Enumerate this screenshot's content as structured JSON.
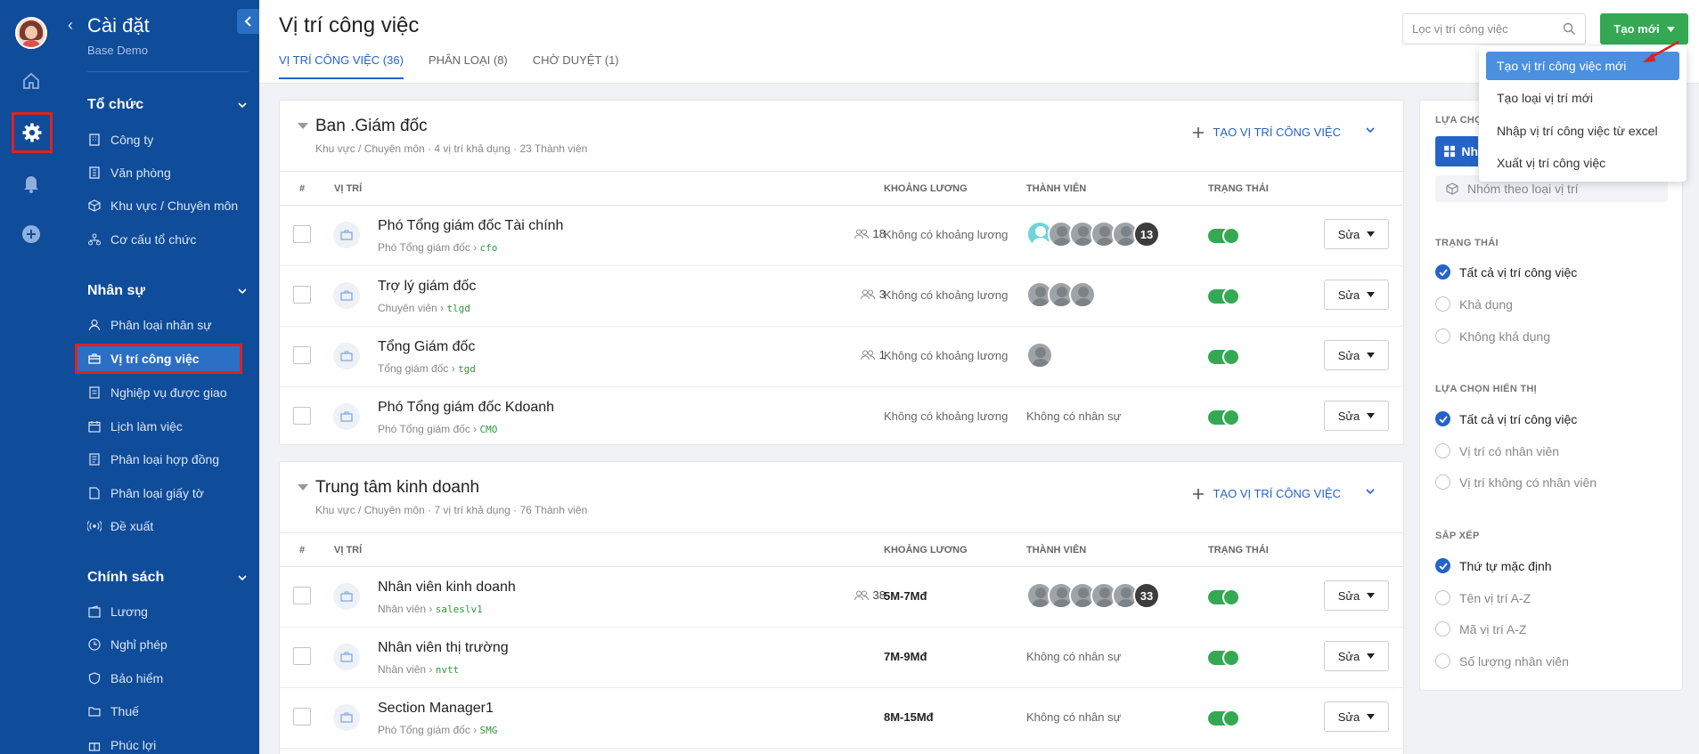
{
  "sidebar": {
    "title": "Cài đặt",
    "subtitle": "Base Demo",
    "groups": [
      {
        "label": "Tổ chức",
        "items": [
          "Công ty",
          "Văn phòng",
          "Khu vực / Chuyên môn",
          "Cơ cấu tổ chức"
        ]
      },
      {
        "label": "Nhân sự",
        "items": [
          "Phân loại nhân sự",
          "Vị trí công việc",
          "Nghiệp vụ được giao",
          "Lịch làm việc",
          "Phân loại hợp đồng",
          "Phân loại giấy tờ",
          "Đề xuất"
        ]
      },
      {
        "label": "Chính sách",
        "items": [
          "Lương",
          "Nghỉ phép",
          "Bảo hiểm",
          "Thuế",
          "Phúc lợi"
        ]
      }
    ]
  },
  "header": {
    "title": "Vị trí công việc",
    "tabs": [
      "VỊ TRÍ CÔNG VIỆC (36)",
      "PHÂN LOẠI (8)",
      "CHỜ DUYỆT (1)"
    ],
    "filter_placeholder": "Lọc vị trí công việc",
    "create_label": "Tạo mới"
  },
  "dropdown": {
    "items": [
      "Tạo vị trí công việc mới",
      "Tạo loại vị trí mới",
      "Nhập vị trí công việc từ excel",
      "Xuất vị trí công việc"
    ]
  },
  "table_headers": [
    "#",
    "VỊ TRÍ",
    "KHOẢNG LƯƠNG",
    "THÀNH VIÊN",
    "TRẠNG THÁI"
  ],
  "add_position_label": "TẠO VỊ TRÍ CÔNG VIỆC",
  "edit_label": "Sửa",
  "cards": [
    {
      "title": "Ban .Giám đốc",
      "meta": "Khu vực / Chuyên môn · 4 vị trí khả dụng · 23 Thành viên",
      "rows": [
        {
          "name": "Phó Tổng giám đốc Tài chính",
          "path": "Phó Tổng giám đốc ›",
          "code": "cfo",
          "count": "18",
          "salary": "Không có khoảng lương",
          "member_extra": "13",
          "no_members": ""
        },
        {
          "name": "Trợ lý giám đốc",
          "path": "Chuyên viên ›",
          "code": "tlgd",
          "count": "3",
          "salary": "Không có khoảng lương",
          "member_extra": "",
          "no_members": ""
        },
        {
          "name": "Tổng Giám đốc",
          "path": "Tổng giám đốc ›",
          "code": "tgd",
          "count": "1",
          "salary": "Không có khoảng lương",
          "member_extra": "",
          "no_members": ""
        },
        {
          "name": "Phó Tổng giám đốc Kdoanh",
          "path": "Phó Tổng giám đốc ›",
          "code": "CMO",
          "count": "",
          "salary": "Không có khoảng lương",
          "member_extra": "",
          "no_members": "Không có nhân sự"
        }
      ]
    },
    {
      "title": "Trung tâm kinh doanh",
      "meta": "Khu vực / Chuyên môn · 7 vị trí khả dụng · 76 Thành viên",
      "rows": [
        {
          "name": "Nhân viên kinh doanh",
          "path": "Nhân viên ›",
          "code": "saleslv1",
          "count": "38",
          "salary": "5M-7Mđ",
          "member_extra": "33",
          "no_members": ""
        },
        {
          "name": "Nhân viên thị trường",
          "path": "Nhân viên ›",
          "code": "nvtt",
          "count": "",
          "salary": "7M-9Mđ",
          "member_extra": "",
          "no_members": "Không có nhân sự"
        },
        {
          "name": "Section Manager1",
          "path": "Phó Tổng giám đốc ›",
          "code": "SMG",
          "count": "",
          "salary": "8M-15Mđ",
          "member_extra": "",
          "no_members": "Không có nhân sự"
        }
      ]
    }
  ],
  "panel": {
    "choose_label": "LỰA CHỌ",
    "button_text": "Nh",
    "group_by_type": "Nhóm theo loại vị trí",
    "status_label": "TRẠNG THÁI",
    "status_options": [
      "Tất cả vị trí công việc",
      "Khả dụng",
      "Không khả dụng"
    ],
    "display_label": "LỰA CHỌN HIỂN THỊ",
    "display_options": [
      "Tất cả vị trí công việc",
      "Vị trí có nhân viên",
      "Vị trí không có nhân viên"
    ],
    "sort_label": "SẮP XẾP",
    "sort_options": [
      "Thứ tự mặc định",
      "Tên vị trí A-Z",
      "Mã vị trí A-Z",
      "Số lượng nhân viên"
    ]
  },
  "colors": {
    "sidebar": "#0f4c9a",
    "accent": "#2563c9",
    "create_button": "#34a853",
    "highlight_box": "#e02020"
  }
}
